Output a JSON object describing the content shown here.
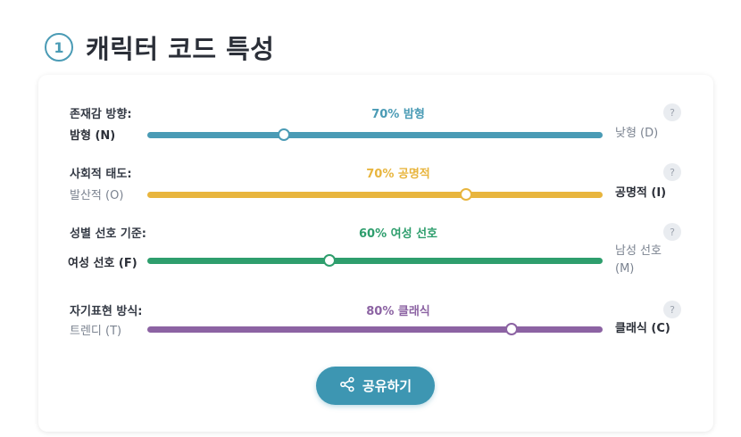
{
  "section": {
    "number": "1",
    "title": "캐릭터 코드 특성"
  },
  "traits": [
    {
      "label": "존재감 방향:",
      "value_text": "70% 밤형",
      "left": "밤형 (N)",
      "right": "낮형 (D)",
      "level_percent": 30,
      "color": "#4a9bb5",
      "help": "?"
    },
    {
      "label": "사회적 태도:",
      "value_text": "70% 공명적",
      "left": "발산적 (O)",
      "right": "공명적 (I)",
      "level_percent": 70,
      "color": "#e8b53e",
      "help": "?"
    },
    {
      "label": "성별 선호 기준:",
      "value_text": "60% 여성 선호",
      "left": "여성 선호 (F)",
      "right": "남성 선호 (M)",
      "level_percent": 40,
      "color": "#2e9e6d",
      "help": "?"
    },
    {
      "label": "자기표현 방식:",
      "value_text": "80% 클래식",
      "left": "트렌디 (T)",
      "right": "클래식 (C)",
      "level_percent": 80,
      "color": "#8c63a3",
      "help": "?"
    }
  ],
  "share_button": {
    "label": "공유하기",
    "icon": "share-icon"
  }
}
